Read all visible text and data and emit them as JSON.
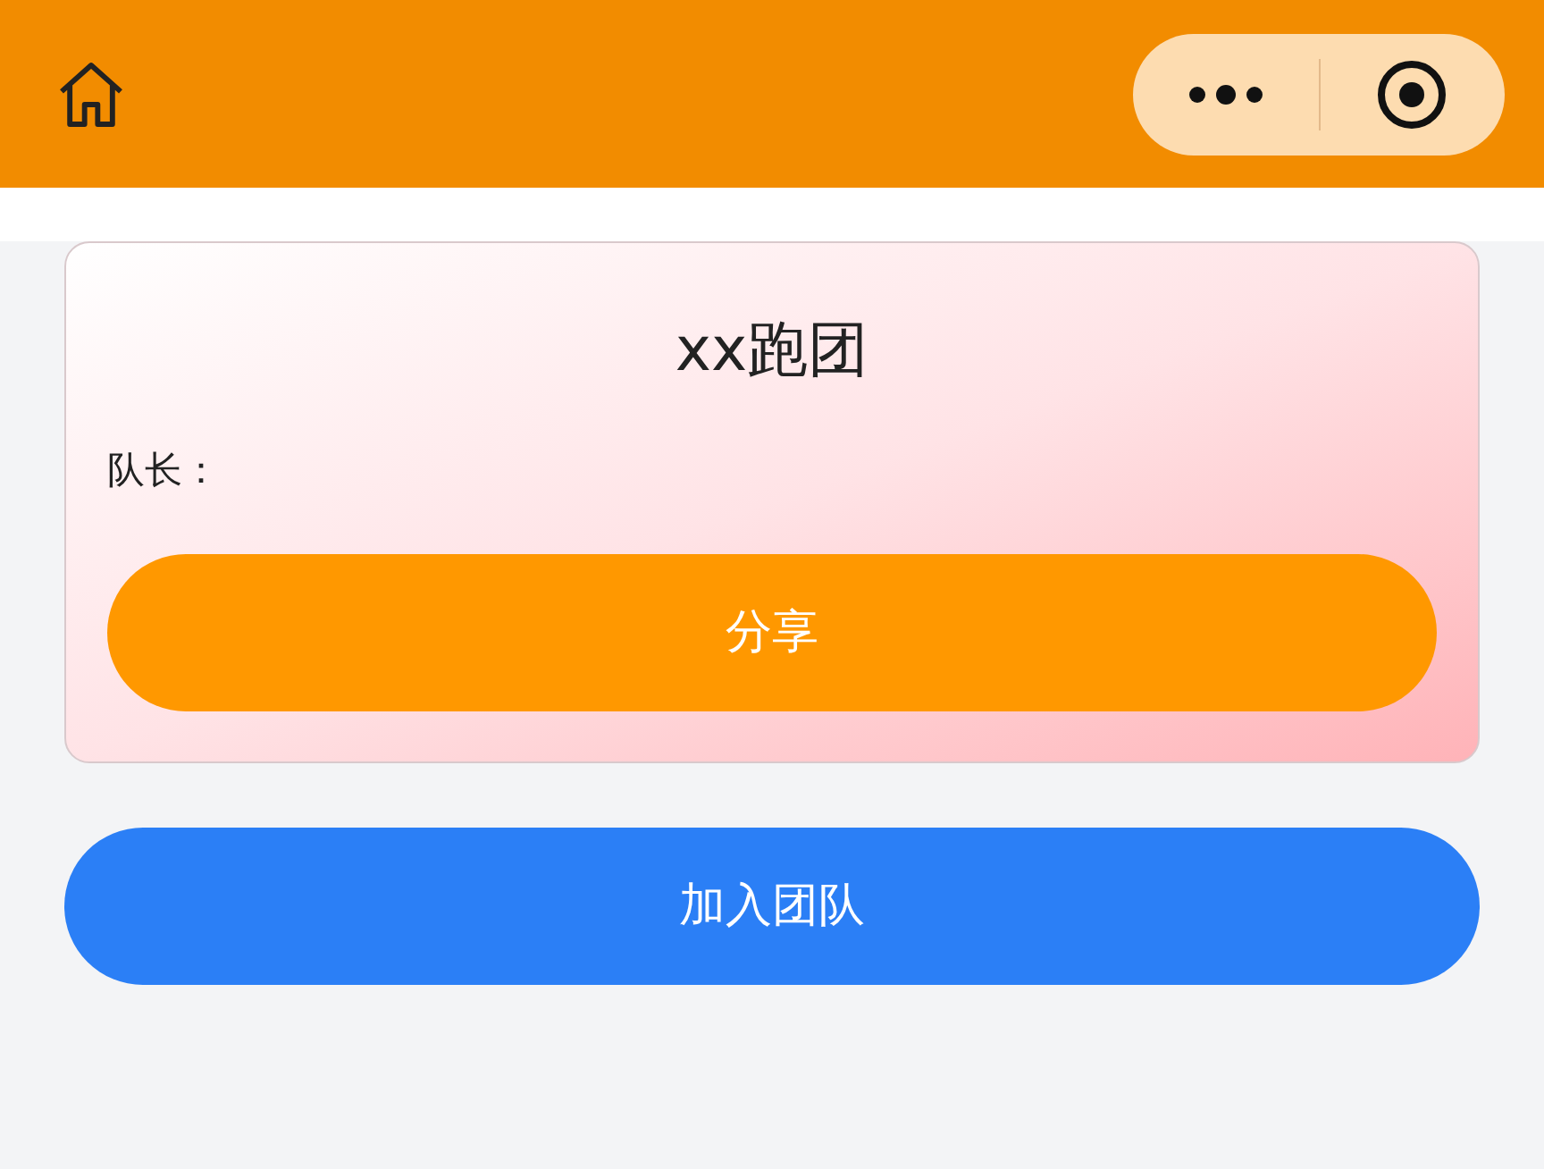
{
  "team": {
    "title": "xx跑团",
    "captain_label": "队长：",
    "share_button": "分享"
  },
  "join_button": "加入团队"
}
